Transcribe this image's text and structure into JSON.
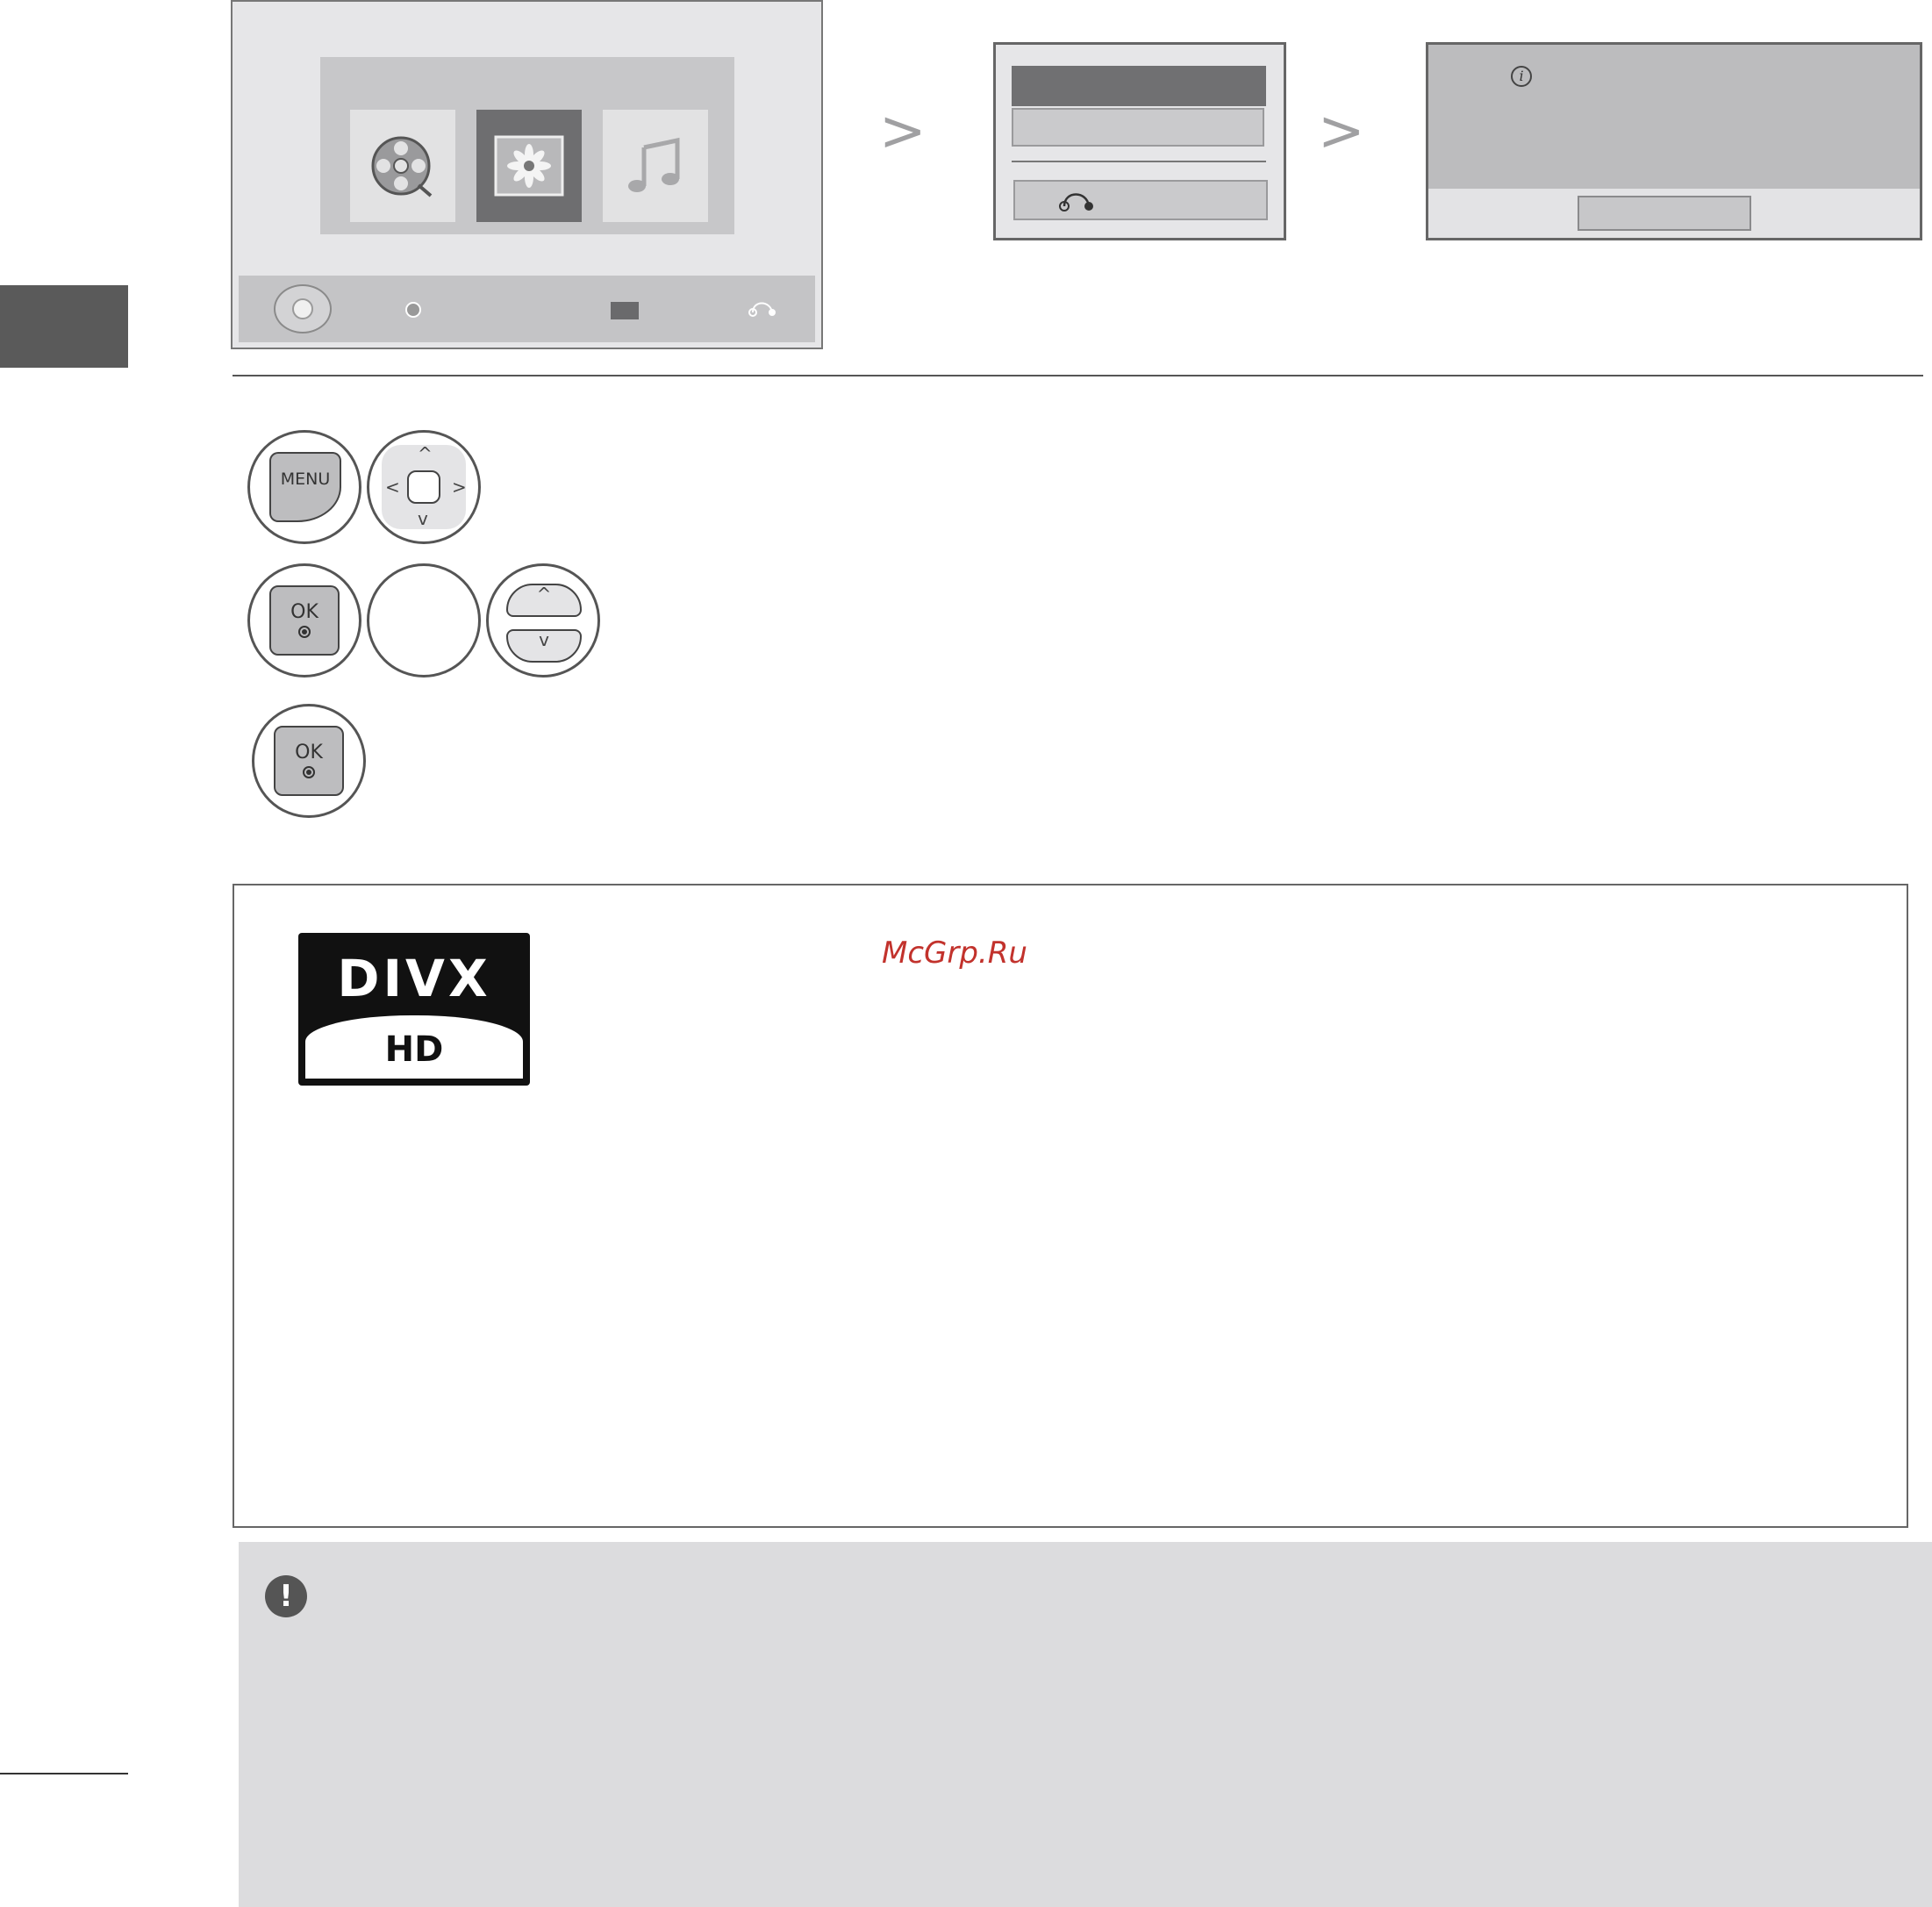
{
  "icons": {
    "movie": "film-reel-icon",
    "photo": "photo-icon",
    "music": "music-note-icon",
    "info": "info-icon",
    "back": "back-arrow-icon",
    "note": "exclamation-icon"
  },
  "screen3": {
    "info_glyph": "i"
  },
  "remote": {
    "menu_label": "MENU",
    "ok_label": "OK",
    "arrows": {
      "up": "^",
      "down": "v",
      "left": "<",
      "right": ">"
    }
  },
  "chevrons": [
    ">",
    ">"
  ],
  "divx_logo": {
    "word": "DIVX",
    "sub": "HD"
  },
  "watermark": "McGrp.Ru",
  "note": {
    "glyph": "!"
  },
  "colors": {
    "watermark": "#c2322c",
    "panel_gray": "#c7c7c9",
    "dark_tab": "#5a5a5a"
  }
}
